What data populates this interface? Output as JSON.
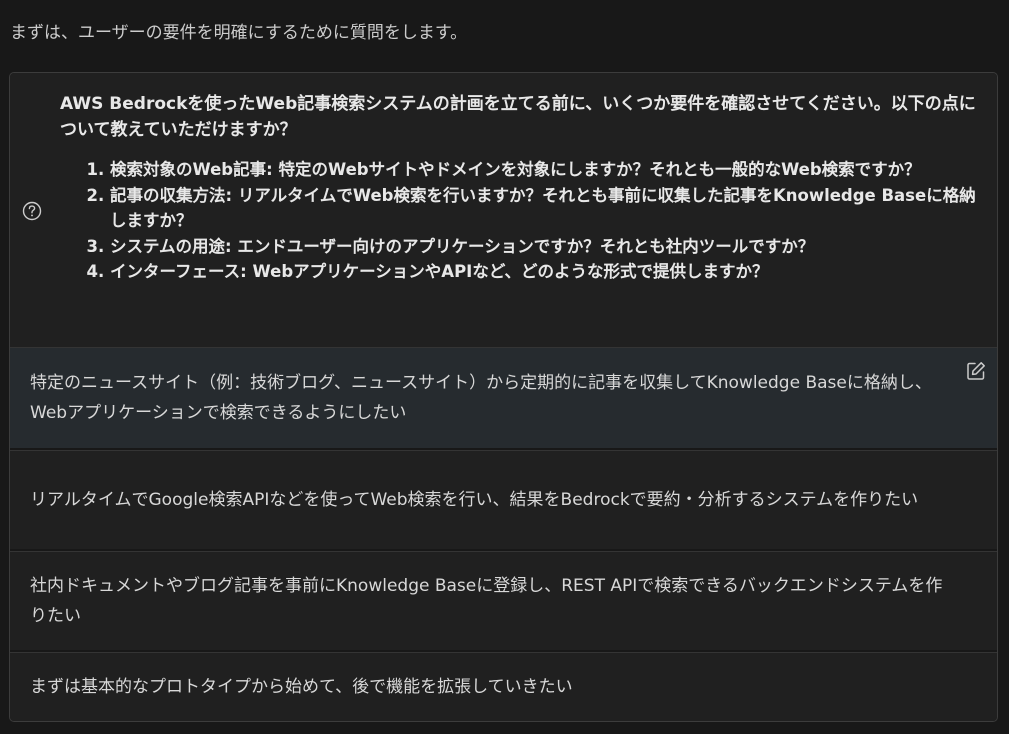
{
  "intro": "まずは、ユーザーの要件を明確にするために質問をします。",
  "question": {
    "icon": "question-circle-icon",
    "lead": "AWS Bedrockを使ったWeb記事検索システムの計画を立てる前に、いくつか要件を確認させてください。以下の点について教えていただけますか？",
    "items": [
      "検索対象のWeb記事: 特定のWebサイトやドメインを対象にしますか？それとも一般的なWeb検索ですか？",
      "記事の収集方法: リアルタイムでWeb検索を行いますか？それとも事前に収集した記事をKnowledge Baseに格納しますか？",
      "システムの用途: エンドユーザー向けのアプリケーションですか？それとも社内ツールですか？",
      "インターフェース: WebアプリケーションやAPIなど、どのような形式で提供しますか？"
    ]
  },
  "options": [
    {
      "label": "特定のニュースサイト（例：技術ブログ、ニュースサイト）から定期的に記事を収集してKnowledge Baseに格納し、Webアプリケーションで検索できるようにしたい",
      "selected": true,
      "icon": "edit-icon"
    },
    {
      "label": "リアルタイムでGoogle検索APIなどを使ってWeb検索を行い、結果をBedrockで要約・分析するシステムを作りたい",
      "selected": false
    },
    {
      "label": "社内ドキュメントやブログ記事を事前にKnowledge Baseに登録し、REST APIで検索できるバックエンドシステムを作りたい",
      "selected": false
    },
    {
      "label": "まずは基本的なプロトタイプから始めて、後で機能を拡張していきたい",
      "selected": false
    }
  ],
  "colors": {
    "background": "#181818",
    "card": "#202020",
    "selected_option": "#262b2f",
    "border": "#3c3c3c",
    "text": "#d8d8d8"
  }
}
